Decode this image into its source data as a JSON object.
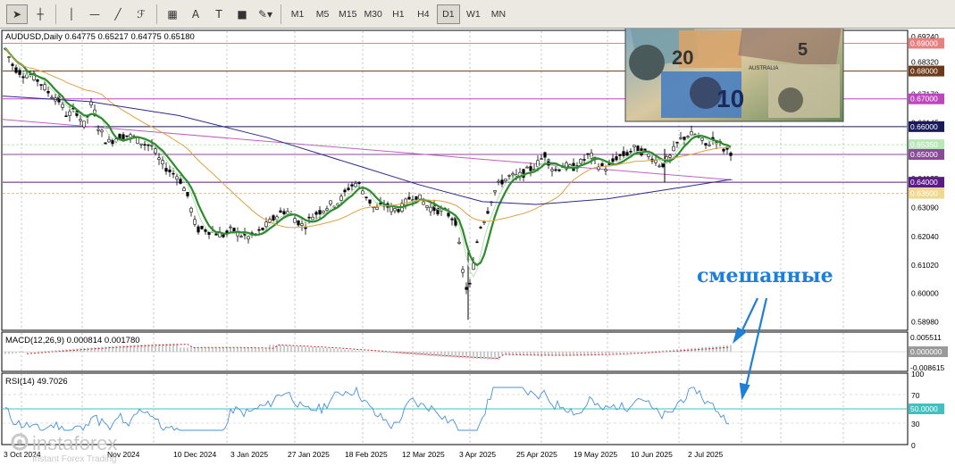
{
  "toolbar": {
    "tools": [
      {
        "name": "cursor-icon",
        "glyph": "➤"
      },
      {
        "name": "crosshair-icon",
        "glyph": "┼"
      },
      {
        "name": "vertical-line-icon",
        "glyph": "│"
      },
      {
        "name": "horizontal-line-icon",
        "glyph": "—"
      },
      {
        "name": "trendline-icon",
        "glyph": "╱"
      },
      {
        "name": "fibonacci-icon",
        "glyph": "ℱ"
      },
      {
        "name": "channel-icon",
        "glyph": "▦"
      },
      {
        "name": "text-icon",
        "glyph": "A"
      },
      {
        "name": "text-label-icon",
        "glyph": "T"
      },
      {
        "name": "rectangle-icon",
        "glyph": "■"
      },
      {
        "name": "shapes-dropdown-icon",
        "glyph": "✎▾"
      }
    ],
    "timeframes": [
      "M1",
      "M5",
      "M15",
      "M30",
      "H1",
      "H4",
      "D1",
      "W1",
      "MN"
    ],
    "active_timeframe": "D1"
  },
  "chart_header": "AUDUSD,Daily  0.64775 0.65217 0.64775 0.65180",
  "macd_label": "MACD(12,26,9) 0.000814 0.001780",
  "rsi_label": "RSI(14) 49.7026",
  "annotation_text": "смешанные",
  "watermark": {
    "brand": "instaforex",
    "tagline": "Instant Forex Trading"
  },
  "price_axis": {
    "ticks": [
      "0.69240",
      "0.68320",
      "0.67170",
      "0.66145",
      "0.65350",
      "0.64125",
      "0.63090",
      "0.62040",
      "0.61020",
      "0.60000",
      "0.58980"
    ],
    "level_labels": [
      {
        "text": "0.69000",
        "bg": "#e88080",
        "fg": "#ffffff"
      },
      {
        "text": "0.68000",
        "bg": "#6b3a1a",
        "fg": "#ffffff"
      },
      {
        "text": "0.67000",
        "bg": "#c044c0",
        "fg": "#ffffff"
      },
      {
        "text": "0.66000",
        "bg": "#1a1a5c",
        "fg": "#ffffff"
      },
      {
        "text": "0.65350",
        "bg": "#b8e8b8",
        "fg": "#ffffff"
      },
      {
        "text": "0.65000",
        "bg": "#8a4a9a",
        "fg": "#ffffff"
      },
      {
        "text": "0.64000",
        "bg": "#5a1a8a",
        "fg": "#ffffff"
      },
      {
        "text": "0.63600",
        "bg": "#f0d890",
        "fg": "#ffffff"
      }
    ]
  },
  "macd_axis": {
    "ticks": [
      "0.005511",
      "0.000000",
      "-0.008615"
    ]
  },
  "rsi_axis": {
    "ticks": [
      "100",
      "70",
      "50.0000",
      "30",
      "0"
    ]
  },
  "time_axis": {
    "labels": [
      "3 Oct 2024",
      "Nov 2024",
      "10 Dec 2024",
      "3 Jan 2025",
      "27 Jan 2025",
      "18 Feb 2025",
      "12 Mar 2025",
      "3 Apr 2025",
      "25 Apr 2025",
      "19 May 2025",
      "10 Jun 2025",
      "2 Jul 2025"
    ]
  },
  "colors": {
    "candle": "#000000",
    "ma_fast": "#2e8b2e",
    "ma_slow": "#e0a040",
    "ma_200": "#2a2a8a",
    "ma_magenta": "#c060c0",
    "annotation": "#1e7fd8",
    "rsi_line": "#4a90d9",
    "rsi_level": "#40c0c0",
    "macd_hist": "#9a9a9a",
    "macd_signal": "#cc2222"
  }
}
